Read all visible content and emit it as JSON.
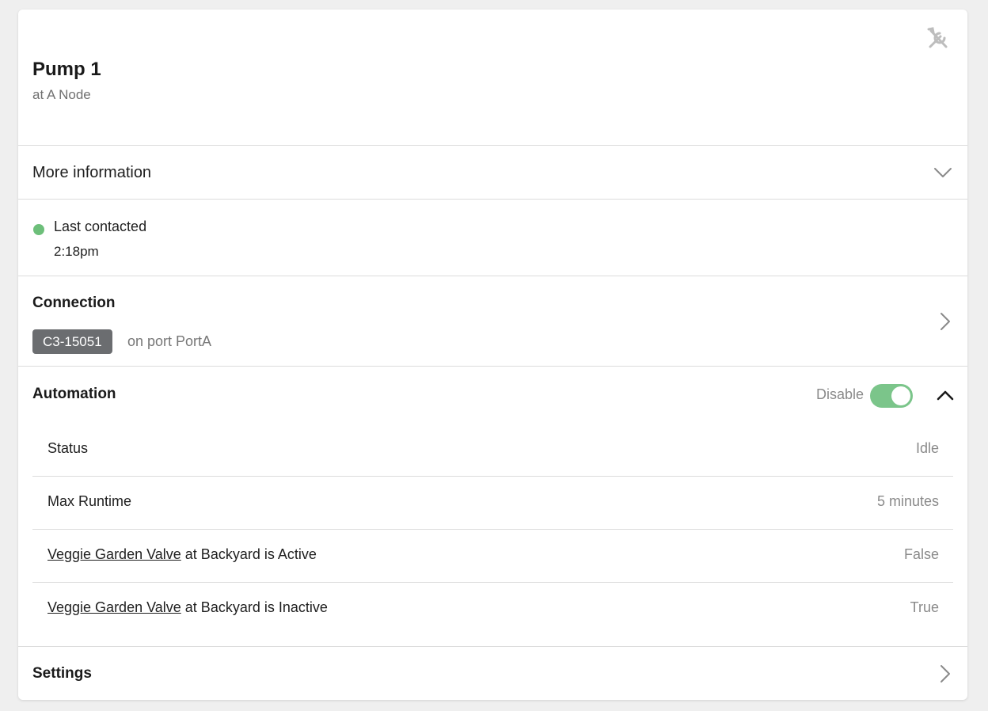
{
  "device": {
    "title": "Pump 1",
    "subtitle": "at A Node"
  },
  "more_info": {
    "label": "More information"
  },
  "contact": {
    "label": "Last contacted",
    "time": "2:18pm",
    "status_color": "#6dbf7a"
  },
  "connection": {
    "title": "Connection",
    "badge": "C3-15051",
    "port_text": "on port PortA"
  },
  "automation": {
    "title": "Automation",
    "toggle_label": "Disable",
    "toggle_on": true,
    "toggle_color": "#7bc58a",
    "rows": [
      {
        "label": "Status",
        "value": "Idle"
      },
      {
        "label": "Max Runtime",
        "value": "5 minutes"
      },
      {
        "link": "Veggie Garden Valve",
        "label": " at Backyard is Active",
        "value": "False"
      },
      {
        "link": "Veggie Garden Valve",
        "label": " at Backyard is Inactive",
        "value": "True"
      }
    ]
  },
  "settings": {
    "title": "Settings"
  },
  "icons": {
    "tools": "tools-icon",
    "more_info": "chevron-down-icon",
    "connection": "chevron-right-icon",
    "automation": "chevron-up-icon",
    "settings": "chevron-right-icon"
  }
}
